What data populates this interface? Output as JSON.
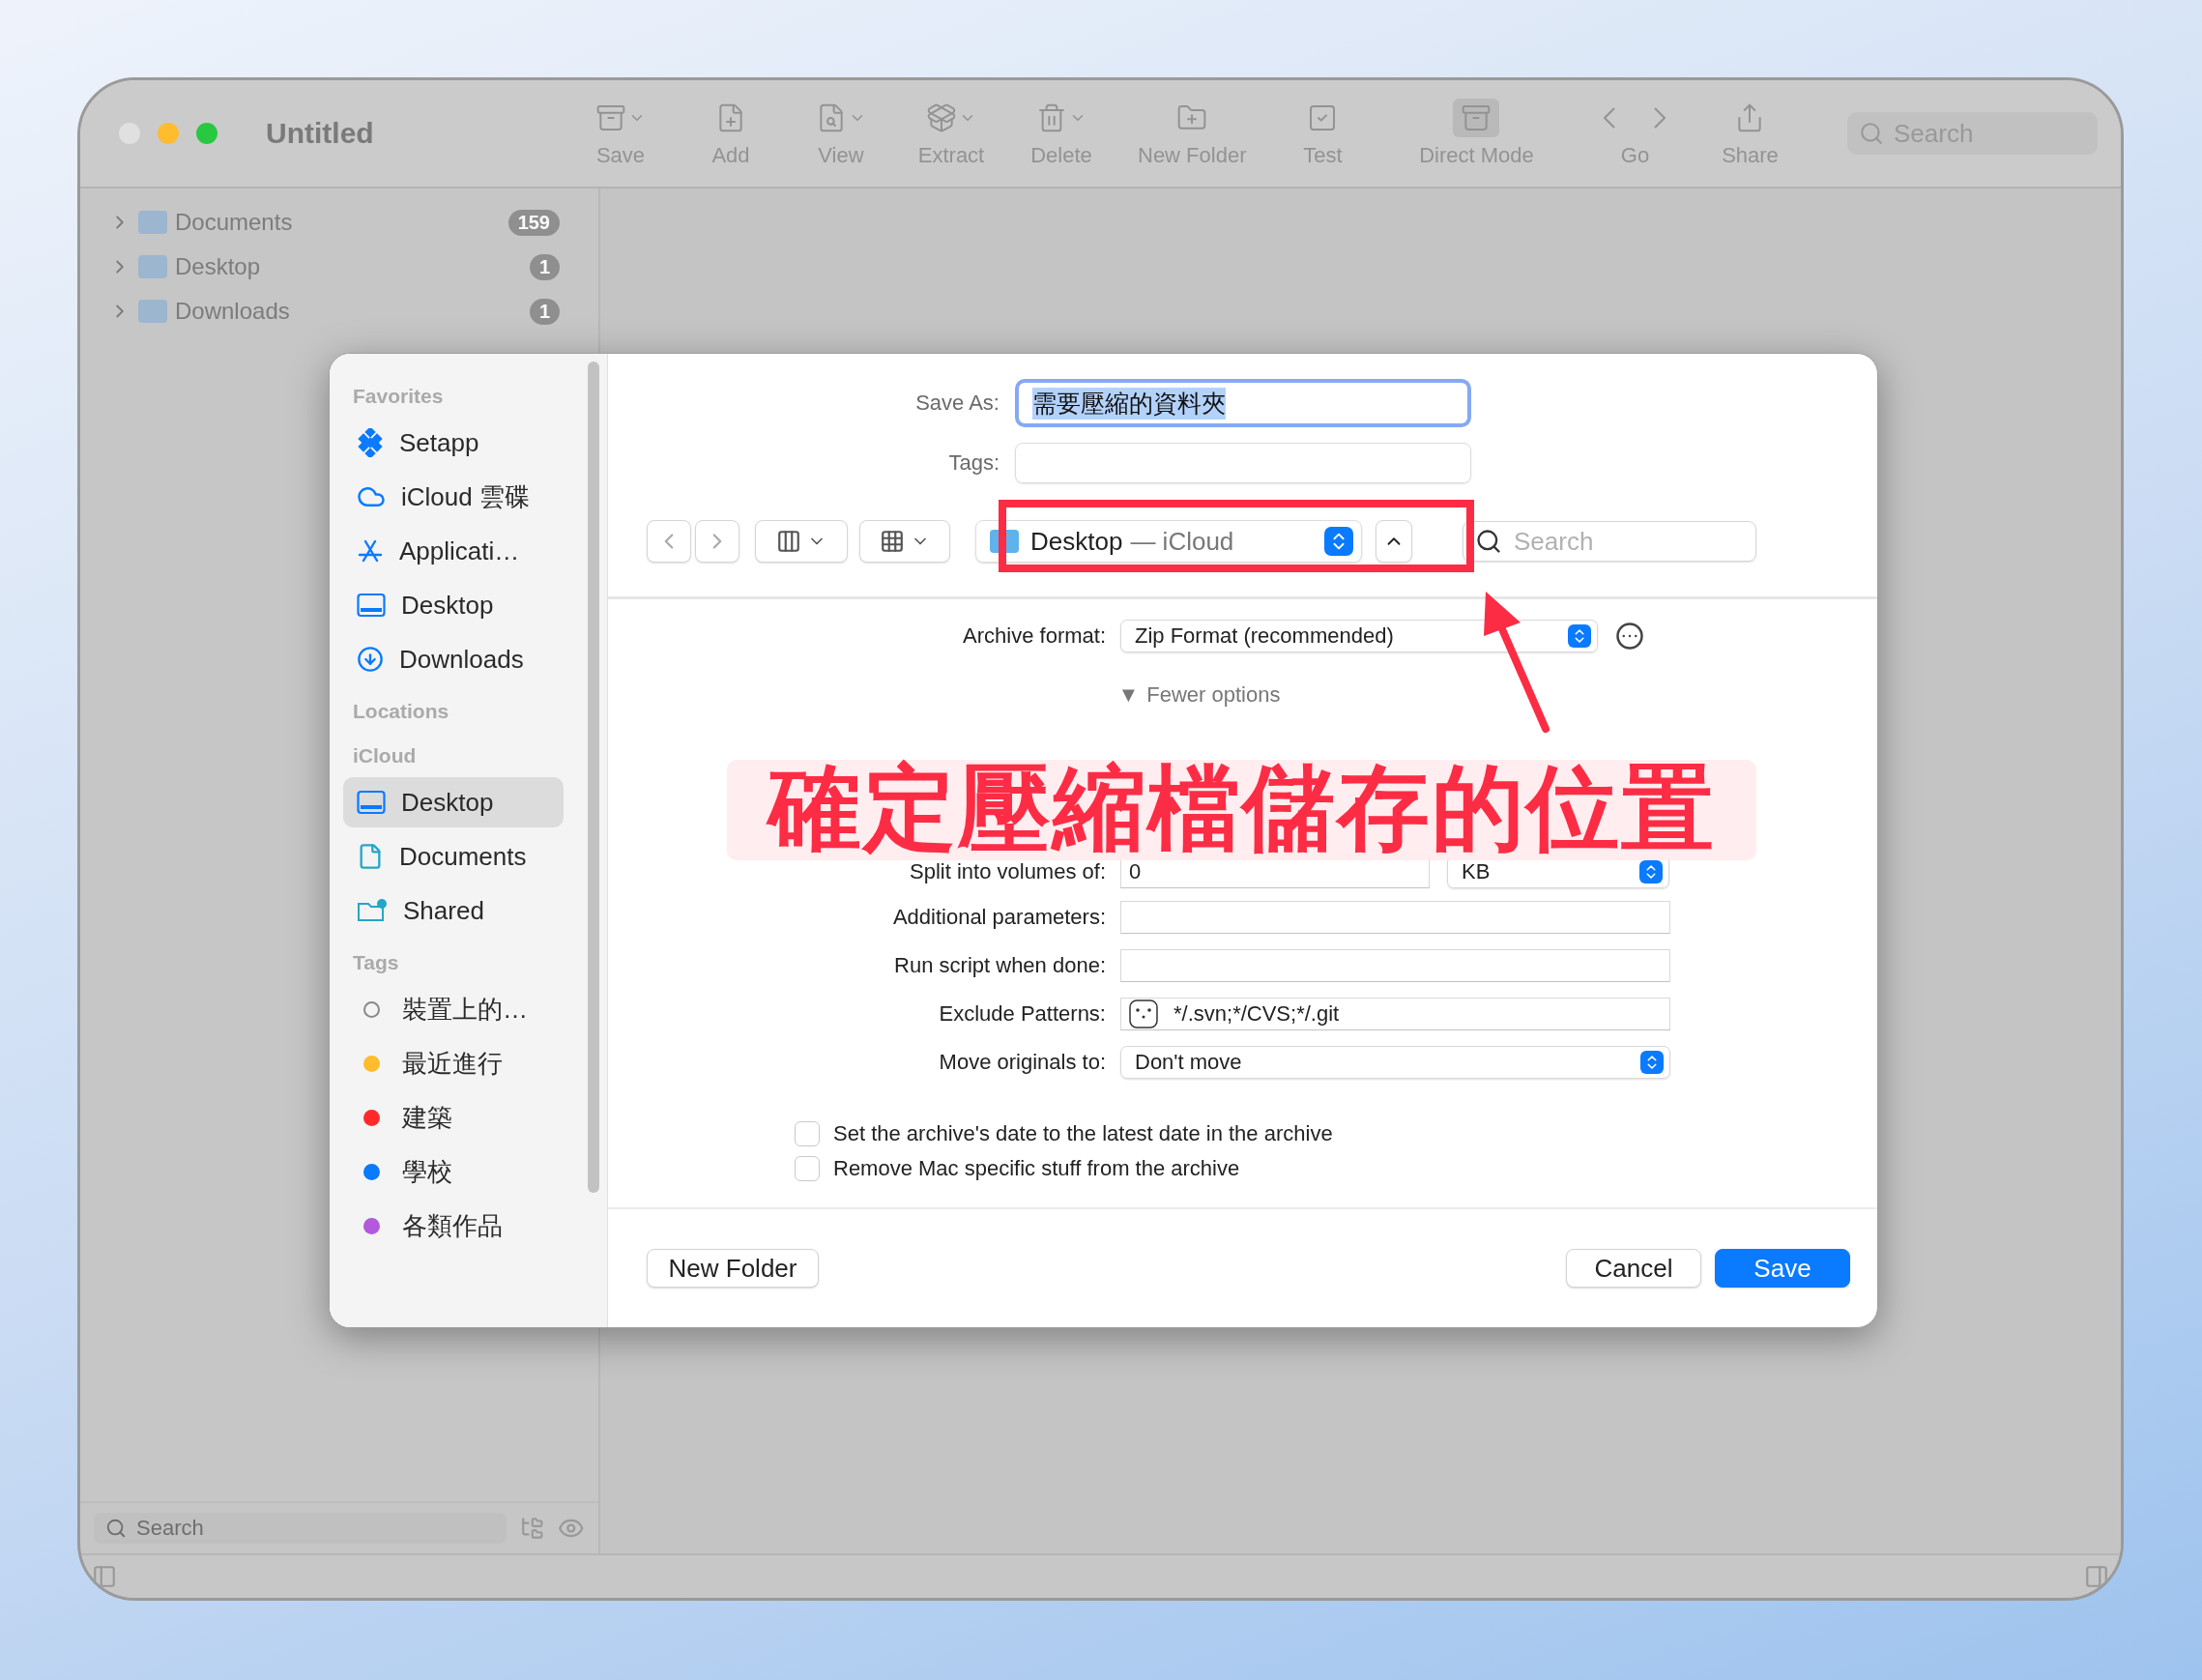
{
  "window": {
    "title": "Untitled"
  },
  "toolbar": {
    "items": [
      {
        "label": "Save",
        "kind": "archive",
        "has_menu": true,
        "selected": false
      },
      {
        "label": "Add",
        "kind": "add",
        "has_menu": false,
        "selected": false
      },
      {
        "label": "View",
        "kind": "view",
        "has_menu": true,
        "selected": false
      },
      {
        "label": "Extract",
        "kind": "extract",
        "has_menu": true,
        "selected": false
      },
      {
        "label": "Delete",
        "kind": "delete",
        "has_menu": true,
        "selected": false
      },
      {
        "label": "New Folder",
        "kind": "folder",
        "has_menu": false,
        "selected": false
      },
      {
        "label": "Test",
        "kind": "test",
        "has_menu": false,
        "selected": false
      },
      {
        "label": "Direct Mode",
        "kind": "direct",
        "has_menu": false,
        "selected": true
      },
      {
        "label": "Go",
        "kind": "nav",
        "has_menu": false,
        "selected": false
      },
      {
        "label": "Share",
        "kind": "share",
        "has_menu": false,
        "selected": false
      }
    ],
    "search": {
      "placeholder": "Search"
    }
  },
  "sidebar": {
    "items": [
      {
        "label": "Documents",
        "count": "159",
        "expanded": false
      },
      {
        "label": "Desktop",
        "count": "1",
        "expanded": false
      },
      {
        "label": "Downloads",
        "count": "1",
        "expanded": false
      }
    ]
  },
  "bottom_search": {
    "placeholder": "Search"
  },
  "dialog": {
    "sidebar": {
      "sections": [
        {
          "title": "Favorites",
          "items": [
            {
              "label": "Setapp",
              "kind": "setapp",
              "selected": false
            },
            {
              "label": "iCloud 雲碟",
              "kind": "cloud",
              "selected": false
            },
            {
              "label": "Applicati…",
              "kind": "apps",
              "selected": false
            },
            {
              "label": "Desktop",
              "kind": "desktop",
              "selected": false
            },
            {
              "label": "Downloads",
              "kind": "download",
              "selected": false
            }
          ]
        },
        {
          "title": "Locations"
        },
        {
          "title": "iCloud",
          "items": [
            {
              "label": "Desktop",
              "kind": "desktop",
              "selected": true
            },
            {
              "label": "Documents",
              "kind": "document",
              "selected": false
            },
            {
              "label": "Shared",
              "kind": "shared",
              "selected": false
            }
          ]
        },
        {
          "title": "Tags",
          "items": [
            {
              "label": "裝置上的…",
              "kind": "outline",
              "color": "#8a8a8a",
              "selected": false
            },
            {
              "label": "最近進行",
              "kind": "dot",
              "color": "#febc2e",
              "selected": false
            },
            {
              "label": "建築",
              "kind": "dot",
              "color": "#ff2a2a",
              "selected": false
            },
            {
              "label": "學校",
              "kind": "dot",
              "color": "#0a7aff",
              "selected": false
            },
            {
              "label": "各類作品",
              "kind": "dot",
              "color": "#b259dc",
              "selected": false
            }
          ]
        }
      ]
    },
    "save_as": {
      "label": "Save As:",
      "value": "需要壓縮的資料夾",
      "text_selected": true
    },
    "tags": {
      "label": "Tags:"
    },
    "location": {
      "name": "Desktop",
      "detail": "— iCloud"
    },
    "search": {
      "placeholder": "Search"
    },
    "archive_format": {
      "label": "Archive format:",
      "value": "Zip Format (recommended)"
    },
    "disclosure": {
      "symbol": "▼",
      "label": "Fewer options"
    },
    "rows": [
      {
        "kind": "split",
        "label": "Split into volumes of:",
        "value": "0",
        "unit": "KB"
      },
      {
        "kind": "text",
        "label": "Additional parameters:"
      },
      {
        "kind": "text",
        "label": "Run script when done:"
      },
      {
        "kind": "patterns",
        "label": "Exclude Patterns:",
        "value": "*/.svn;*/CVS;*/.git"
      },
      {
        "kind": "popup",
        "label": "Move originals to:",
        "value": "Don't move"
      }
    ],
    "checkboxes": [
      {
        "label": "Set the archive's date to the latest date in the archive",
        "checked": false
      },
      {
        "label": "Remove Mac specific stuff from the archive",
        "checked": false
      }
    ],
    "buttons": [
      {
        "label": "New Folder",
        "kind": "secondary"
      },
      {
        "label": "Cancel",
        "kind": "secondary"
      },
      {
        "label": "Save",
        "kind": "primary"
      }
    ]
  },
  "annotation": {
    "text": "確定壓縮檔儲存的位置"
  }
}
